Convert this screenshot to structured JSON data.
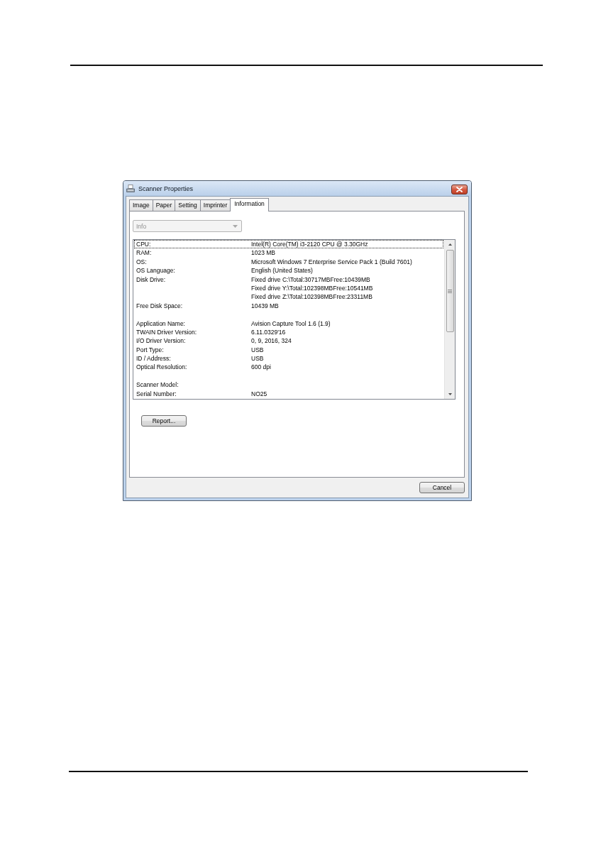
{
  "window": {
    "title": "Scanner Properties"
  },
  "tabs": [
    {
      "label": "Image",
      "selected": false
    },
    {
      "label": "Paper",
      "selected": false
    },
    {
      "label": "Setting",
      "selected": false
    },
    {
      "label": "Imprinter",
      "selected": false
    },
    {
      "label": "Information",
      "selected": true
    }
  ],
  "dropdown": {
    "value": "Info",
    "disabled": true
  },
  "info_list": {
    "groups": [
      {
        "rows": [
          {
            "label": "CPU:",
            "value": "Intel(R) Core(TM) i3-2120 CPU @ 3.30GHz",
            "focused": true
          },
          {
            "label": "RAM:",
            "value": "1023 MB",
            "focused": false
          },
          {
            "label": "OS:",
            "value": "Microsoft Windows 7 Enterprise Service Pack 1 (Build 7601)",
            "focused": false
          },
          {
            "label": "OS Language:",
            "value": "English (United States)",
            "focused": false
          },
          {
            "label": "Disk Drive:",
            "value": "Fixed drive C:\\Total:30717MBFree:10439MB",
            "focused": false
          },
          {
            "value": "Fixed drive Y:\\Total:102398MBFree:10541MB",
            "focused": false
          },
          {
            "value": "Fixed drive Z:\\Total:102398MBFree:23311MB",
            "focused": false
          },
          {
            "label": "Free Disk Space:",
            "value": "10439 MB",
            "focused": false
          }
        ]
      },
      {
        "rows": [
          {
            "label": "Application Name:",
            "value": "Avision Capture Tool 1.6 (1.9)",
            "focused": false
          },
          {
            "label": "TWAIN Driver Version:",
            "value": "6.11.0329'16",
            "focused": false
          },
          {
            "label": "I/O Driver Version:",
            "value": "0, 9, 2016, 324",
            "focused": false
          },
          {
            "label": "Port Type:",
            "value": "USB",
            "focused": false
          },
          {
            "label": "ID / Address:",
            "value": "USB",
            "focused": false
          },
          {
            "label": "Optical Resolution:",
            "value": "600 dpi",
            "focused": false
          }
        ]
      },
      {
        "rows": [
          {
            "label": "Scanner Model:",
            "focused": false
          },
          {
            "label": "Serial Number:",
            "value": "NO25",
            "focused": false
          }
        ]
      }
    ]
  },
  "report_button": {
    "label": "Report..."
  },
  "cancel_button": {
    "label": "Cancel"
  }
}
